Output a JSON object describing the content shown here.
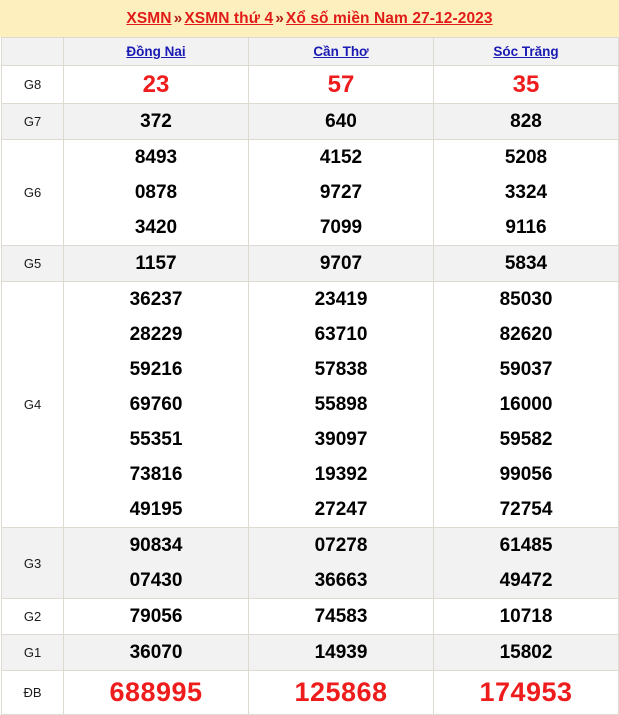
{
  "header": {
    "crumb_1": "XSMN",
    "sep_1": "»",
    "crumb_2": "XSMN thứ 4",
    "sep_2": "»",
    "crumb_3": "Xổ số miền Nam 27-12-2023",
    "background_color": "#fdf0be",
    "link_color": "#e01b18"
  },
  "table": {
    "label_header": "",
    "provinces": [
      "Đồng Nai",
      "Cần Thơ",
      "Sóc Trăng"
    ],
    "province_link_color": "#1a1ab4",
    "highlight_color": "#ee1c1c",
    "rows": [
      {
        "prize": "G8",
        "values": [
          [
            "23"
          ],
          [
            "57"
          ],
          [
            "35"
          ]
        ]
      },
      {
        "prize": "G7",
        "values": [
          [
            "372"
          ],
          [
            "640"
          ],
          [
            "828"
          ]
        ]
      },
      {
        "prize": "G6",
        "values": [
          [
            "8493",
            "0878",
            "3420"
          ],
          [
            "4152",
            "9727",
            "7099"
          ],
          [
            "5208",
            "3324",
            "9116"
          ]
        ]
      },
      {
        "prize": "G5",
        "values": [
          [
            "1157"
          ],
          [
            "9707"
          ],
          [
            "5834"
          ]
        ]
      },
      {
        "prize": "G4",
        "values": [
          [
            "36237",
            "28229",
            "59216",
            "69760",
            "55351",
            "73816",
            "49195"
          ],
          [
            "23419",
            "63710",
            "57838",
            "55898",
            "39097",
            "19392",
            "27247"
          ],
          [
            "85030",
            "82620",
            "59037",
            "16000",
            "59582",
            "99056",
            "72754"
          ]
        ]
      },
      {
        "prize": "G3",
        "values": [
          [
            "90834",
            "07430"
          ],
          [
            "07278",
            "36663"
          ],
          [
            "61485",
            "49472"
          ]
        ]
      },
      {
        "prize": "G2",
        "values": [
          [
            "79056"
          ],
          [
            "74583"
          ],
          [
            "10718"
          ]
        ]
      },
      {
        "prize": "G1",
        "values": [
          [
            "36070"
          ],
          [
            "14939"
          ],
          [
            "15802"
          ]
        ]
      },
      {
        "prize": "ĐB",
        "values": [
          [
            "688995"
          ],
          [
            "125868"
          ],
          [
            "174953"
          ]
        ]
      }
    ]
  }
}
